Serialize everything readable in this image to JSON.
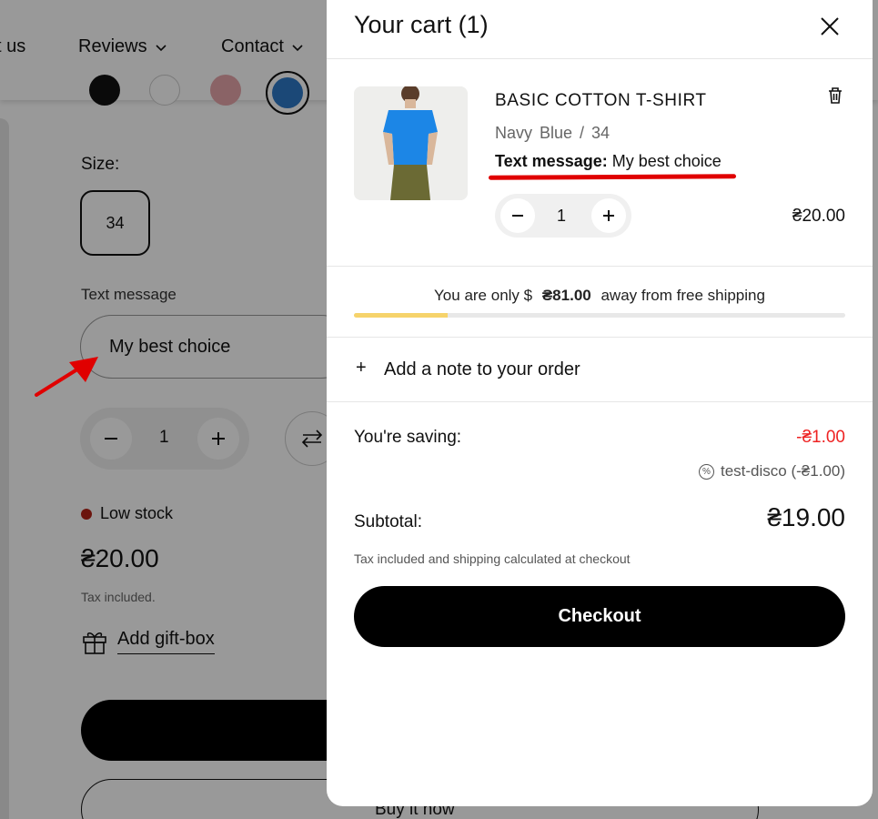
{
  "nav": {
    "items": [
      {
        "label": "t us",
        "has_chevron": false
      },
      {
        "label": "Reviews",
        "has_chevron": true
      },
      {
        "label": "Contact",
        "has_chevron": true
      }
    ]
  },
  "product_page": {
    "swatch_colors": [
      "#111111",
      "#ffffff",
      "#e7a6aa",
      "#2e79c7"
    ],
    "size_label": "Size:",
    "size_value": "34",
    "text_message_label": "Text message",
    "text_message_value": "My best choice",
    "quantity": "1",
    "stock_status": "Low stock",
    "price": "₴20.00",
    "tax_note": "Tax included.",
    "gift_box_label": "Add gift-box",
    "buy_now_label": "Buy it now"
  },
  "cart": {
    "title": "Your cart (1)",
    "item": {
      "name": "BASIC COTTON T-SHIRT",
      "variant": "Navy Blue / 34",
      "property_name": "Text message:",
      "property_value": "My best choice",
      "quantity": "1",
      "price": "₴20.00"
    },
    "shipping": {
      "prefix": "You are only $",
      "amount": "₴81.00",
      "suffix": "away from free shipping",
      "progress_fraction": 0.19
    },
    "note_label": "Add a note to your order",
    "saving_label": "You're saving:",
    "saving_value": "-₴1.00",
    "discount_code": "test-disco (-₴1.00)",
    "subtotal_label": "Subtotal:",
    "subtotal_value": "₴19.00",
    "tax_shipping_note": "Tax included and shipping calculated at checkout",
    "checkout_label": "Checkout"
  },
  "colors": {
    "accent_red": "#e00000",
    "progress_yellow": "#f6d36b",
    "discount_red": "#e22222",
    "stock_dot": "#b42318"
  },
  "icons": {
    "close": "close-icon",
    "trash": "trash-icon",
    "minus": "minus-icon",
    "plus": "plus-icon",
    "gift": "gift-icon",
    "discount": "discount-tag-icon",
    "annotation_arrow": "arrow-icon"
  }
}
